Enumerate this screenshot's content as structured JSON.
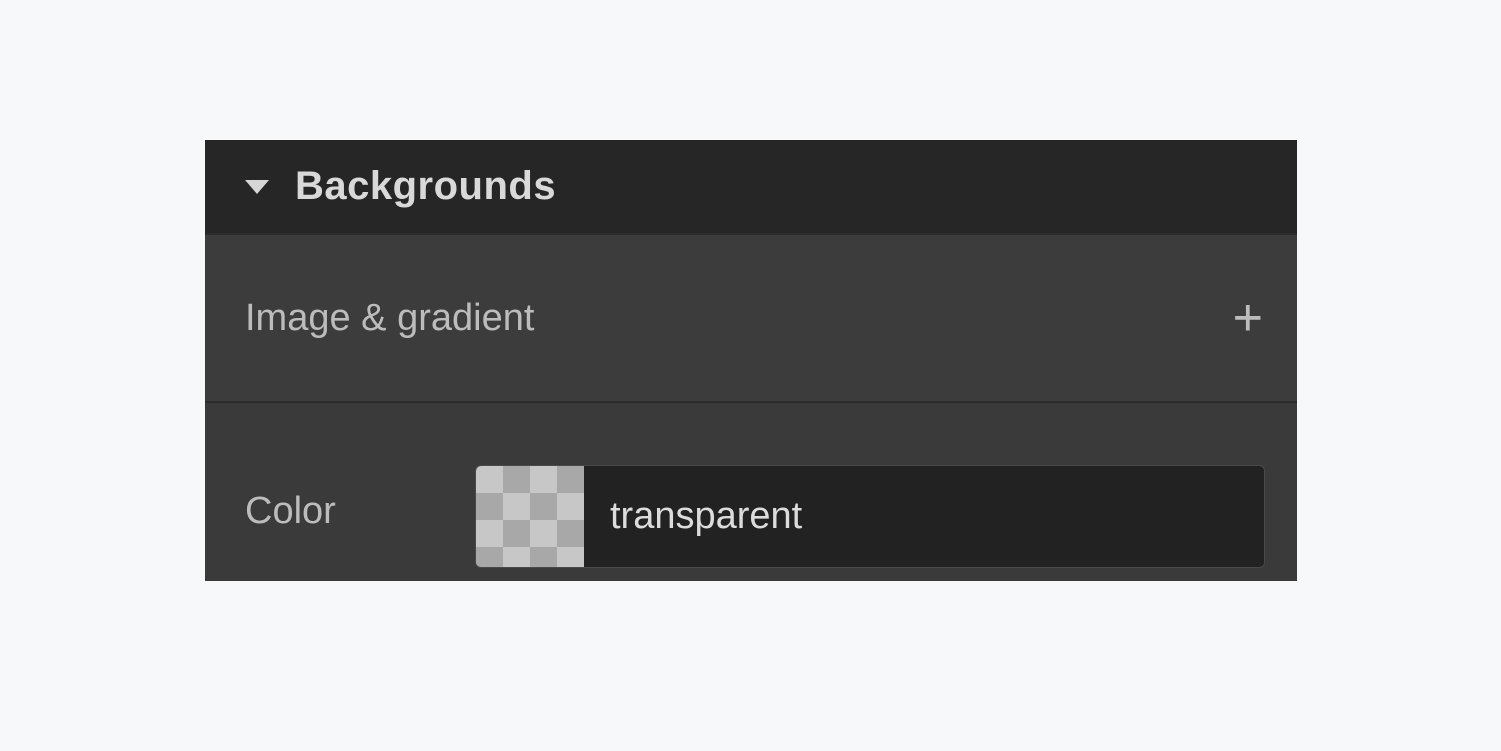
{
  "panel": {
    "title": "Backgrounds",
    "rows": {
      "image_gradient": {
        "label": "Image & gradient"
      },
      "color": {
        "label": "Color",
        "value": "transparent"
      }
    }
  }
}
